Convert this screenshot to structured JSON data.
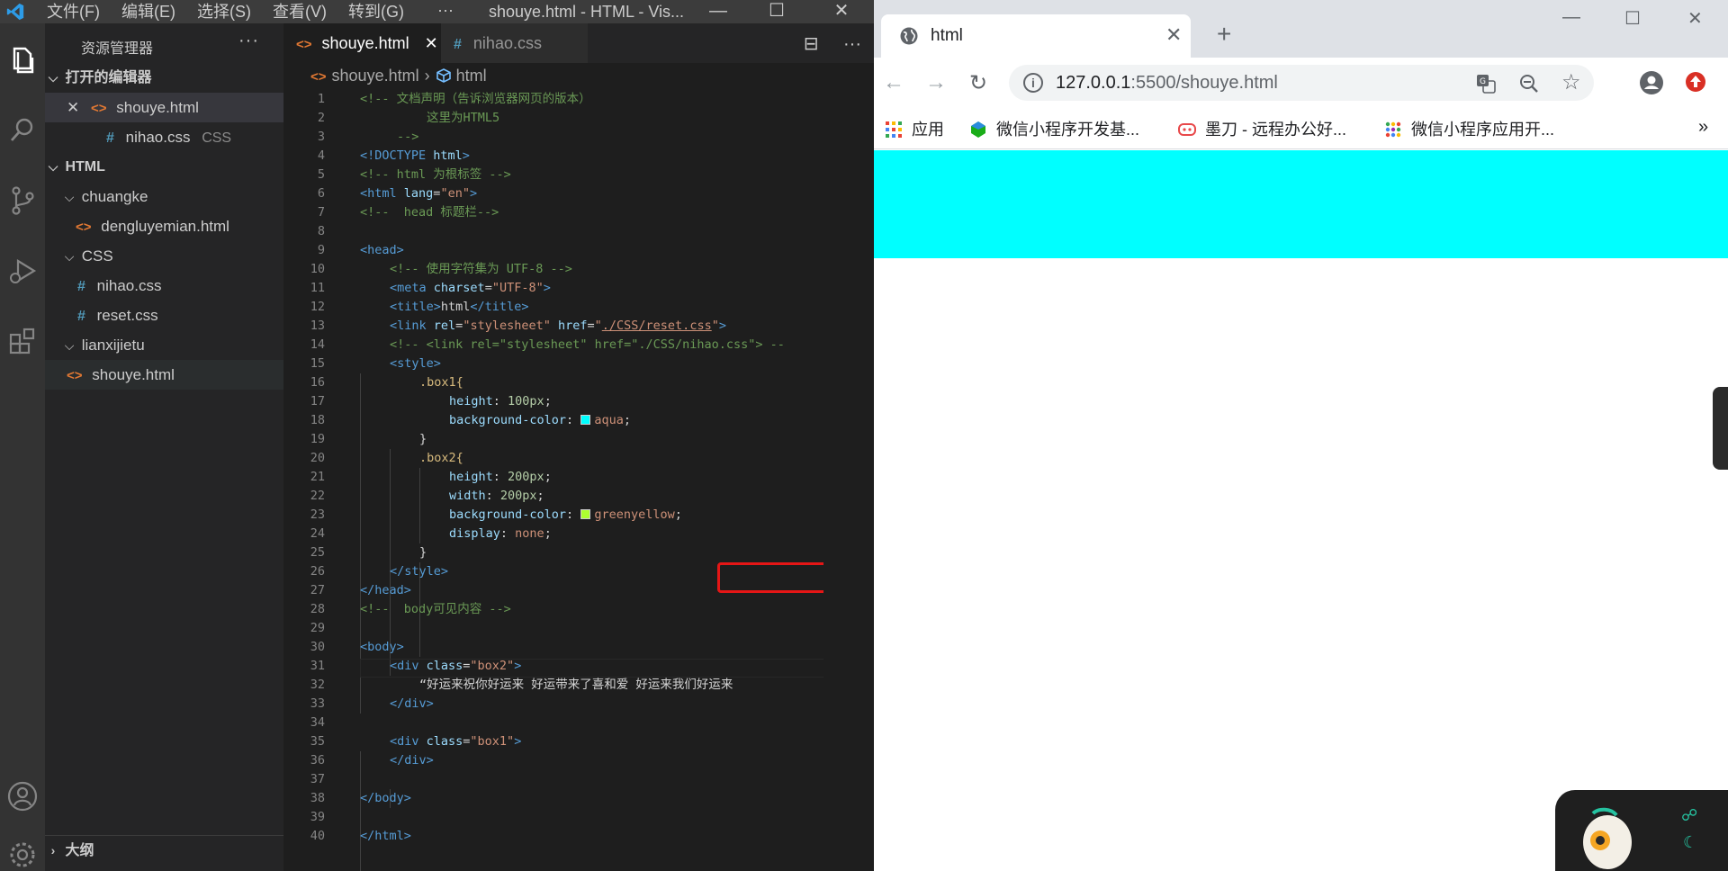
{
  "vscode": {
    "menu": [
      "文件(F)",
      "编辑(E)",
      "选择(S)",
      "查看(V)",
      "转到(G)"
    ],
    "menu_more": "···",
    "window_title": "shouye.html - HTML - Vis...",
    "sidebar": {
      "title": "资源管理器",
      "more": "···",
      "open_editors_label": "打开的编辑器",
      "open_editors": [
        {
          "name": "shouye.html",
          "type": "html",
          "close": "✕"
        },
        {
          "name": "nihao.css",
          "type": "css",
          "sub": "CSS"
        }
      ],
      "workspace_label": "HTML",
      "tree": [
        {
          "name": "chuangke",
          "kind": "folder"
        },
        {
          "name": "dengluyemian.html",
          "kind": "html"
        },
        {
          "name": "CSS",
          "kind": "folder"
        },
        {
          "name": "nihao.css",
          "kind": "css"
        },
        {
          "name": "reset.css",
          "kind": "css"
        },
        {
          "name": "lianxijietu",
          "kind": "folder"
        },
        {
          "name": "shouye.html",
          "kind": "html"
        }
      ],
      "outline_label": "大纲"
    },
    "tabs": [
      {
        "label": "shouye.html",
        "active": true,
        "close": "✕"
      },
      {
        "label": "nihao.css",
        "active": false
      }
    ],
    "tab_actions": [
      "⊟",
      "···"
    ],
    "breadcrumb": {
      "file": "shouye.html",
      "symbol": "html"
    },
    "line_numbers": [
      "1",
      "2",
      "3",
      "4",
      "5",
      "6",
      "7",
      "8",
      "9",
      "10",
      "11",
      "12",
      "13",
      "14",
      "15",
      "16",
      "17",
      "18",
      "19",
      "20",
      "21",
      "22",
      "23",
      "24",
      "25",
      "26",
      "27",
      "28",
      "29",
      "30",
      "31",
      "32",
      "33",
      "34",
      "35",
      "36",
      "37",
      "38",
      "39",
      "40"
    ],
    "code": {
      "l1": "<!-- 文档声明（告诉浏览器网页的版本）",
      "l2": "这里为HTML5",
      "l3": "-->",
      "l4a": "<!DOCTYPE ",
      "l4b": "html",
      "l4c": ">",
      "l5": "<!-- html 为根标签 -->",
      "l6a": "<html ",
      "l6b": "lang",
      "l6c": "=",
      "l6d": "\"en\"",
      "l6e": ">",
      "l7": "<!--  head 标题栏-->",
      "l9": "<head>",
      "l10": "<!-- 使用字符集为 UTF-8 -->",
      "l11a": "<meta ",
      "l11b": "charset",
      "l11c": "=",
      "l11d": "\"UTF-8\"",
      "l11e": ">",
      "l12a": "<title>",
      "l12b": "html",
      "l12c": "</title>",
      "l13a": "<link ",
      "l13b": "rel",
      "l13c": "=",
      "l13d": "\"stylesheet\"",
      "l13e": " href",
      "l13f": "=",
      "l13g": "\"",
      "l13h": "./CSS/reset.css",
      "l13i": "\"",
      "l13j": ">",
      "l14": "<!-- <link rel=\"stylesheet\" href=\"./CSS/nihao.css\"> --",
      "l15": "<style>",
      "l16": ".box1{",
      "l17a": "height",
      "l17b": ": ",
      "l17c": "100px",
      "l17d": ";",
      "l18a": "background-color",
      "l18b": ": ",
      "l18c": "aqua",
      "l18d": ";",
      "l19": "}",
      "l20": ".box2{",
      "l21a": "height",
      "l21b": ": ",
      "l21c": "200px",
      "l21d": ";",
      "l22a": "width",
      "l22b": ": ",
      "l22c": "200px",
      "l22d": ";",
      "l23a": "background-color",
      "l23b": ": ",
      "l23c": "greenyellow",
      "l23d": ";",
      "l24a": "display",
      "l24b": ": ",
      "l24c": "none",
      "l24d": ";",
      "l25": "}",
      "l26": "</style>",
      "l27": "</head>",
      "l28": "<!--  body可见内容 -->",
      "l30": "<body>",
      "l31a": "<div ",
      "l31b": "class",
      "l31c": "=",
      "l31d": "\"box2\"",
      "l31e": ">",
      "l32": "“好运来祝你好运来 好运带来了喜和爱 好运来我们好运来",
      "l33": "</div>",
      "l35a": "<div ",
      "l35b": "class",
      "l35c": "=",
      "l35d": "\"box1\"",
      "l35e": ">",
      "l36": "</div>",
      "l38": "</body>",
      "l40": "</html>"
    },
    "swatches": {
      "aqua": "#00ffff",
      "greenyellow": "#adff2f"
    }
  },
  "browser": {
    "tab_title": "html",
    "tab_close": "✕",
    "new_tab": "+",
    "window_controls": [
      "—",
      "☐",
      "✕"
    ],
    "url_host": "127.0.0.1",
    "url_rest": ":5500/shouye.html",
    "bookmarks": [
      {
        "label": "应用"
      },
      {
        "label": "微信小程序开发基..."
      },
      {
        "label": "墨刀 - 远程办公好..."
      },
      {
        "label": "微信小程序应用开..."
      }
    ],
    "bookmarks_more": "»",
    "page": {
      "box1_color": "#00ffff"
    }
  }
}
